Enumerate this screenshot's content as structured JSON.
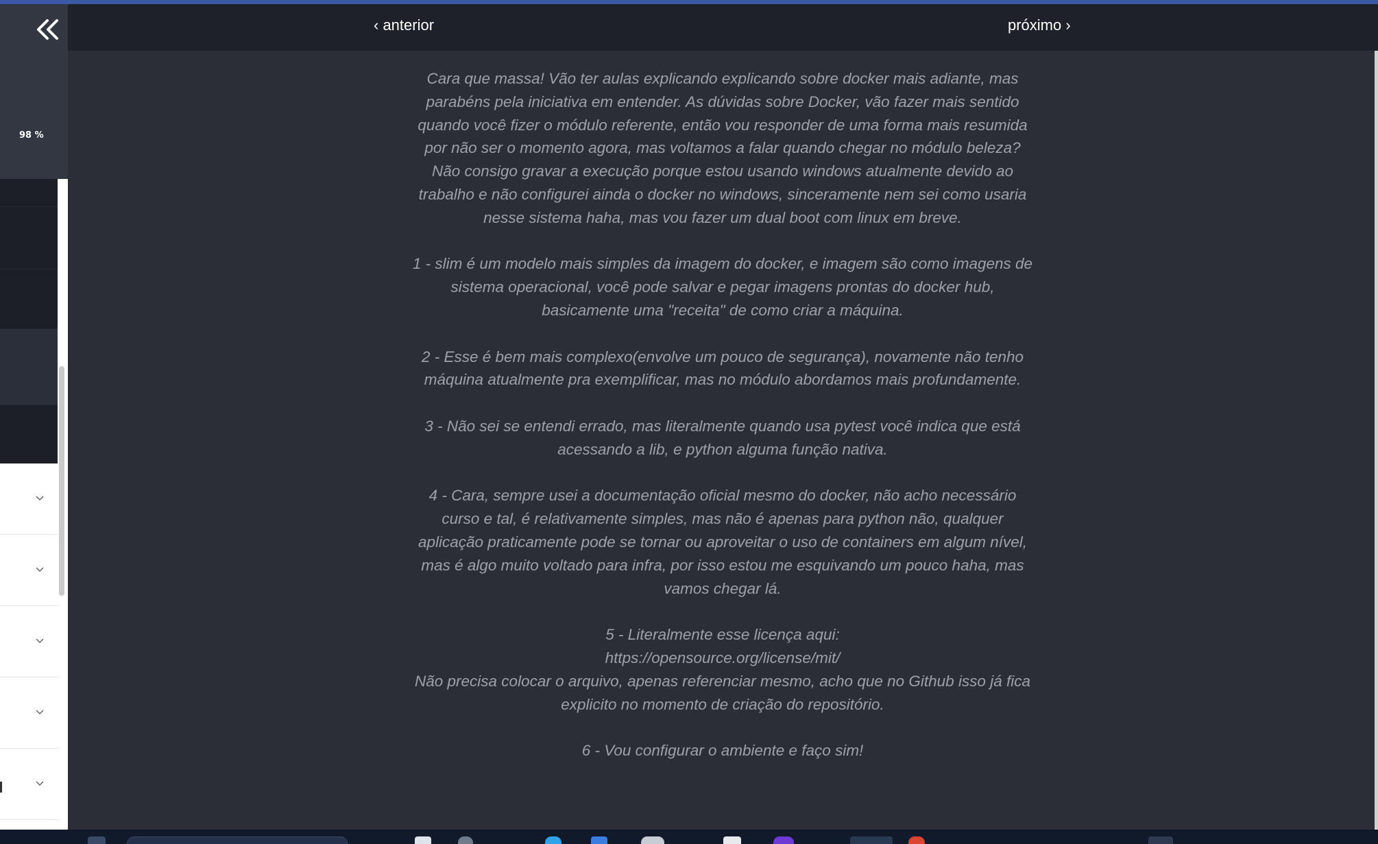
{
  "sidebar": {
    "progress_label": "98 %",
    "collapse_icon": "double-chevron-left-icon"
  },
  "nav": {
    "prev_label": "‹ anterior",
    "next_label": "próximo ›"
  },
  "message": {
    "paragraphs": [
      "Cara que massa! Vão ter aulas explicando explicando sobre docker mais adiante, mas parabéns pela iniciativa em entender. As dúvidas sobre Docker, vão fazer mais sentido quando você fizer o módulo referente, então vou responder de uma forma mais resumida por não ser o momento agora, mas voltamos a falar quando chegar no módulo beleza? Não consigo gravar a execução porque estou usando windows atualmente devido ao trabalho e não configurei ainda o docker no windows, sinceramente nem sei como usaria nesse sistema haha, mas vou fazer um dual boot com linux em breve.",
      "1 - slim é um modelo mais simples da imagem do docker, e imagem são como imagens de sistema operacional, você pode salvar e pegar imagens prontas do docker hub, basicamente uma \"receita\" de como criar a máquina.",
      "2 - Esse é bem mais complexo(envolve um pouco de segurança), novamente não tenho máquina atualmente pra exemplificar, mas no módulo abordamos mais profundamente.",
      "3 - Não sei se entendi errado, mas literalmente quando usa pytest você indica que está acessando a lib, e python alguma função nativa.",
      "4 - Cara, sempre usei a documentação oficial mesmo do docker, não acho necessário curso e tal, é relativamente simples, mas não é apenas para python não, qualquer aplicação praticamente pode se tornar ou aproveitar o uso de containers em algum nível, mas é algo muito voltado para infra, por isso estou me esquivando um pouco haha, mas vamos chegar lá.",
      "5 - Literalmente esse licença aqui:",
      "https://opensource.org/license/mit/",
      "Não precisa colocar o arquivo, apenas referenciar mesmo, acho que no Github isso já fica explicito no momento de criação do repositório.",
      "6 - Vou configurar o ambiente e faço sim!"
    ]
  },
  "colors": {
    "accent": "#3d63e8",
    "background": "#2b2e36",
    "nav_bg": "#1e2129",
    "text_muted": "#9da1aa"
  }
}
